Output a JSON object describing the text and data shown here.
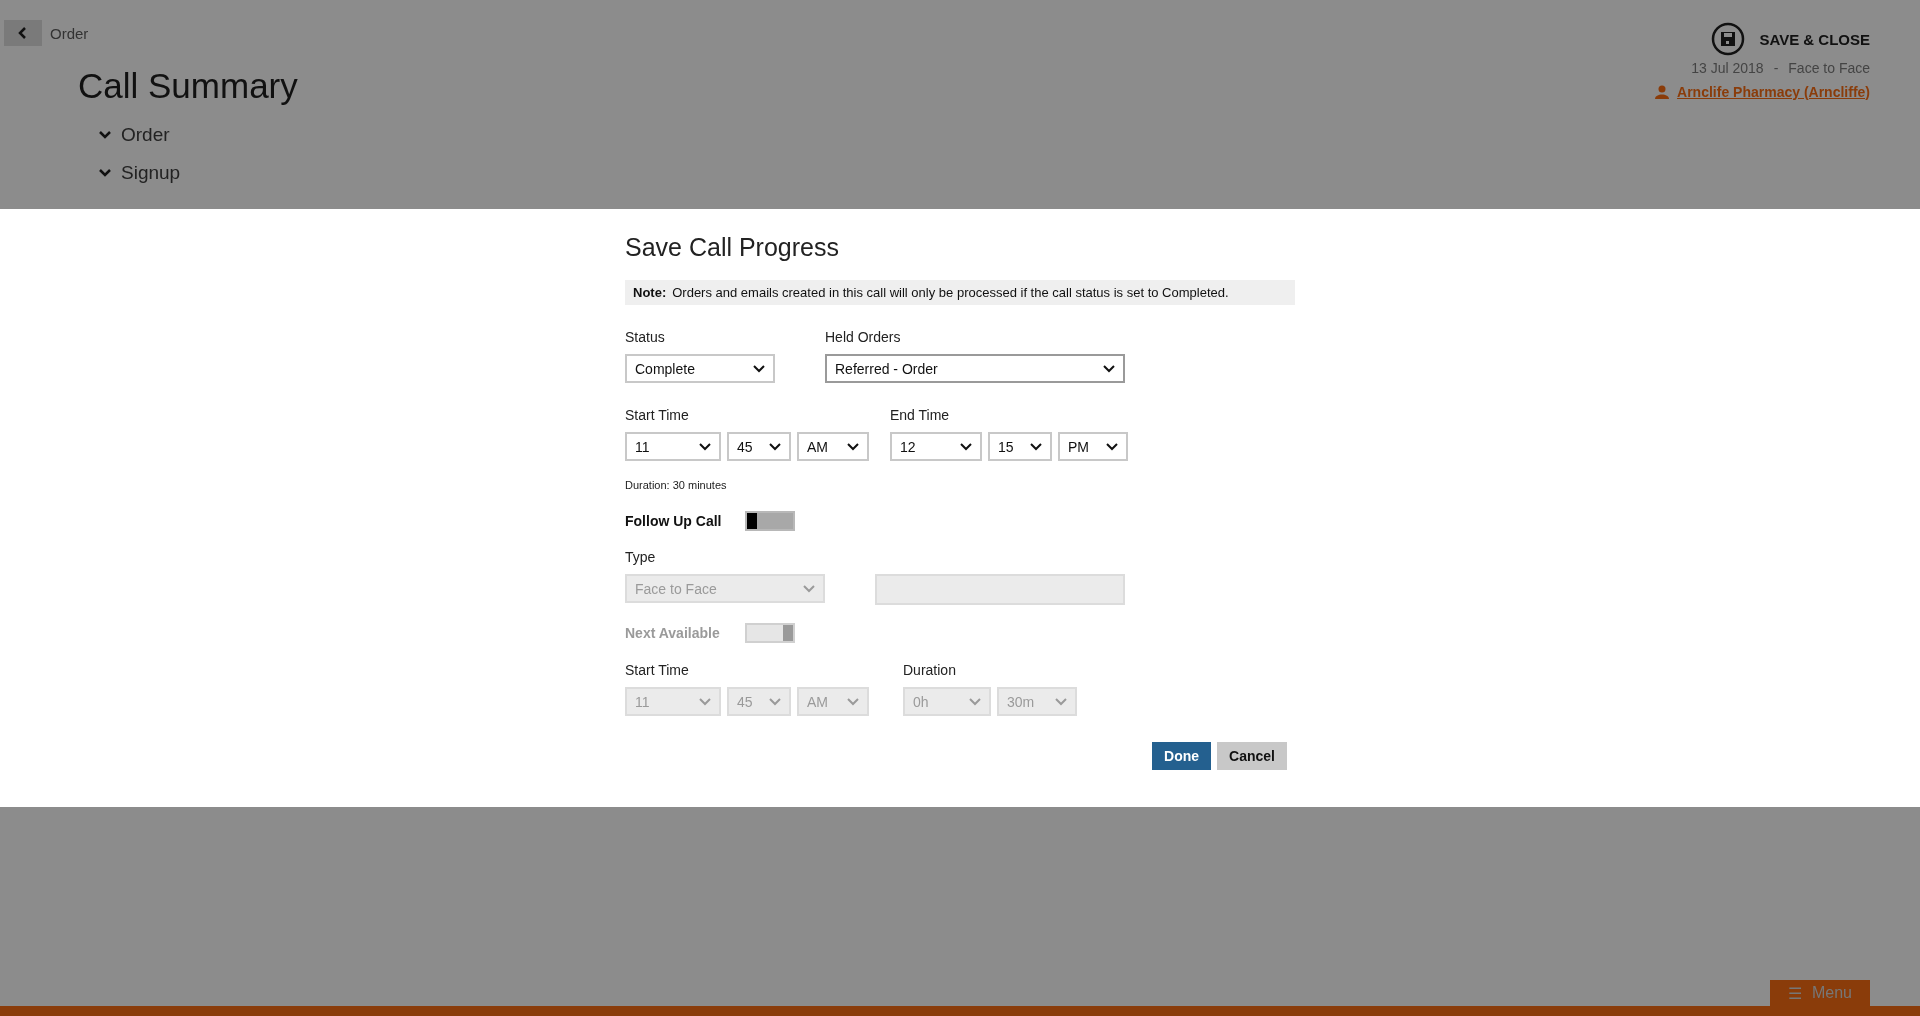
{
  "header": {
    "back_label": "Order",
    "title": "Call Summary",
    "sections": [
      {
        "label": "Order",
        "expanded": true
      },
      {
        "label": "Signup",
        "expanded": true
      }
    ],
    "save_label": "SAVE & CLOSE",
    "date": "13 Jul 2018",
    "separator": "-",
    "call_type": "Face to Face",
    "customer": "Arnclife Pharmacy (Arncliffe)"
  },
  "dialog": {
    "title": "Save Call Progress",
    "note_label": "Note:",
    "note": "Orders and emails created in this call will only be processed if the call status is set to Completed.",
    "status": {
      "label": "Status",
      "value": "Complete"
    },
    "held_orders": {
      "label": "Held Orders",
      "value": "Referred - Order"
    },
    "start_time": {
      "label": "Start Time",
      "hour": "11",
      "minute": "45",
      "period": "AM"
    },
    "end_time": {
      "label": "End Time",
      "hour": "12",
      "minute": "15",
      "period": "PM"
    },
    "duration_text": "Duration: 30 minutes",
    "follow_up": {
      "label": "Follow Up Call",
      "on": false,
      "disabled": false
    },
    "type": {
      "label": "Type",
      "value": "Face to Face",
      "disabled": true
    },
    "next_available": {
      "label": "Next Available",
      "on": true,
      "disabled": true
    },
    "follow_start": {
      "label": "Start Time",
      "hour": "11",
      "minute": "45",
      "period": "AM",
      "disabled": true
    },
    "follow_duration": {
      "label": "Duration",
      "hours": "0h",
      "minutes": "30m",
      "disabled": true
    },
    "buttons": [
      {
        "label": "Done",
        "kind": "primary"
      },
      {
        "label": "Cancel",
        "kind": "secondary"
      }
    ]
  },
  "menu_button": {
    "icon": "☰",
    "label": "Menu"
  }
}
